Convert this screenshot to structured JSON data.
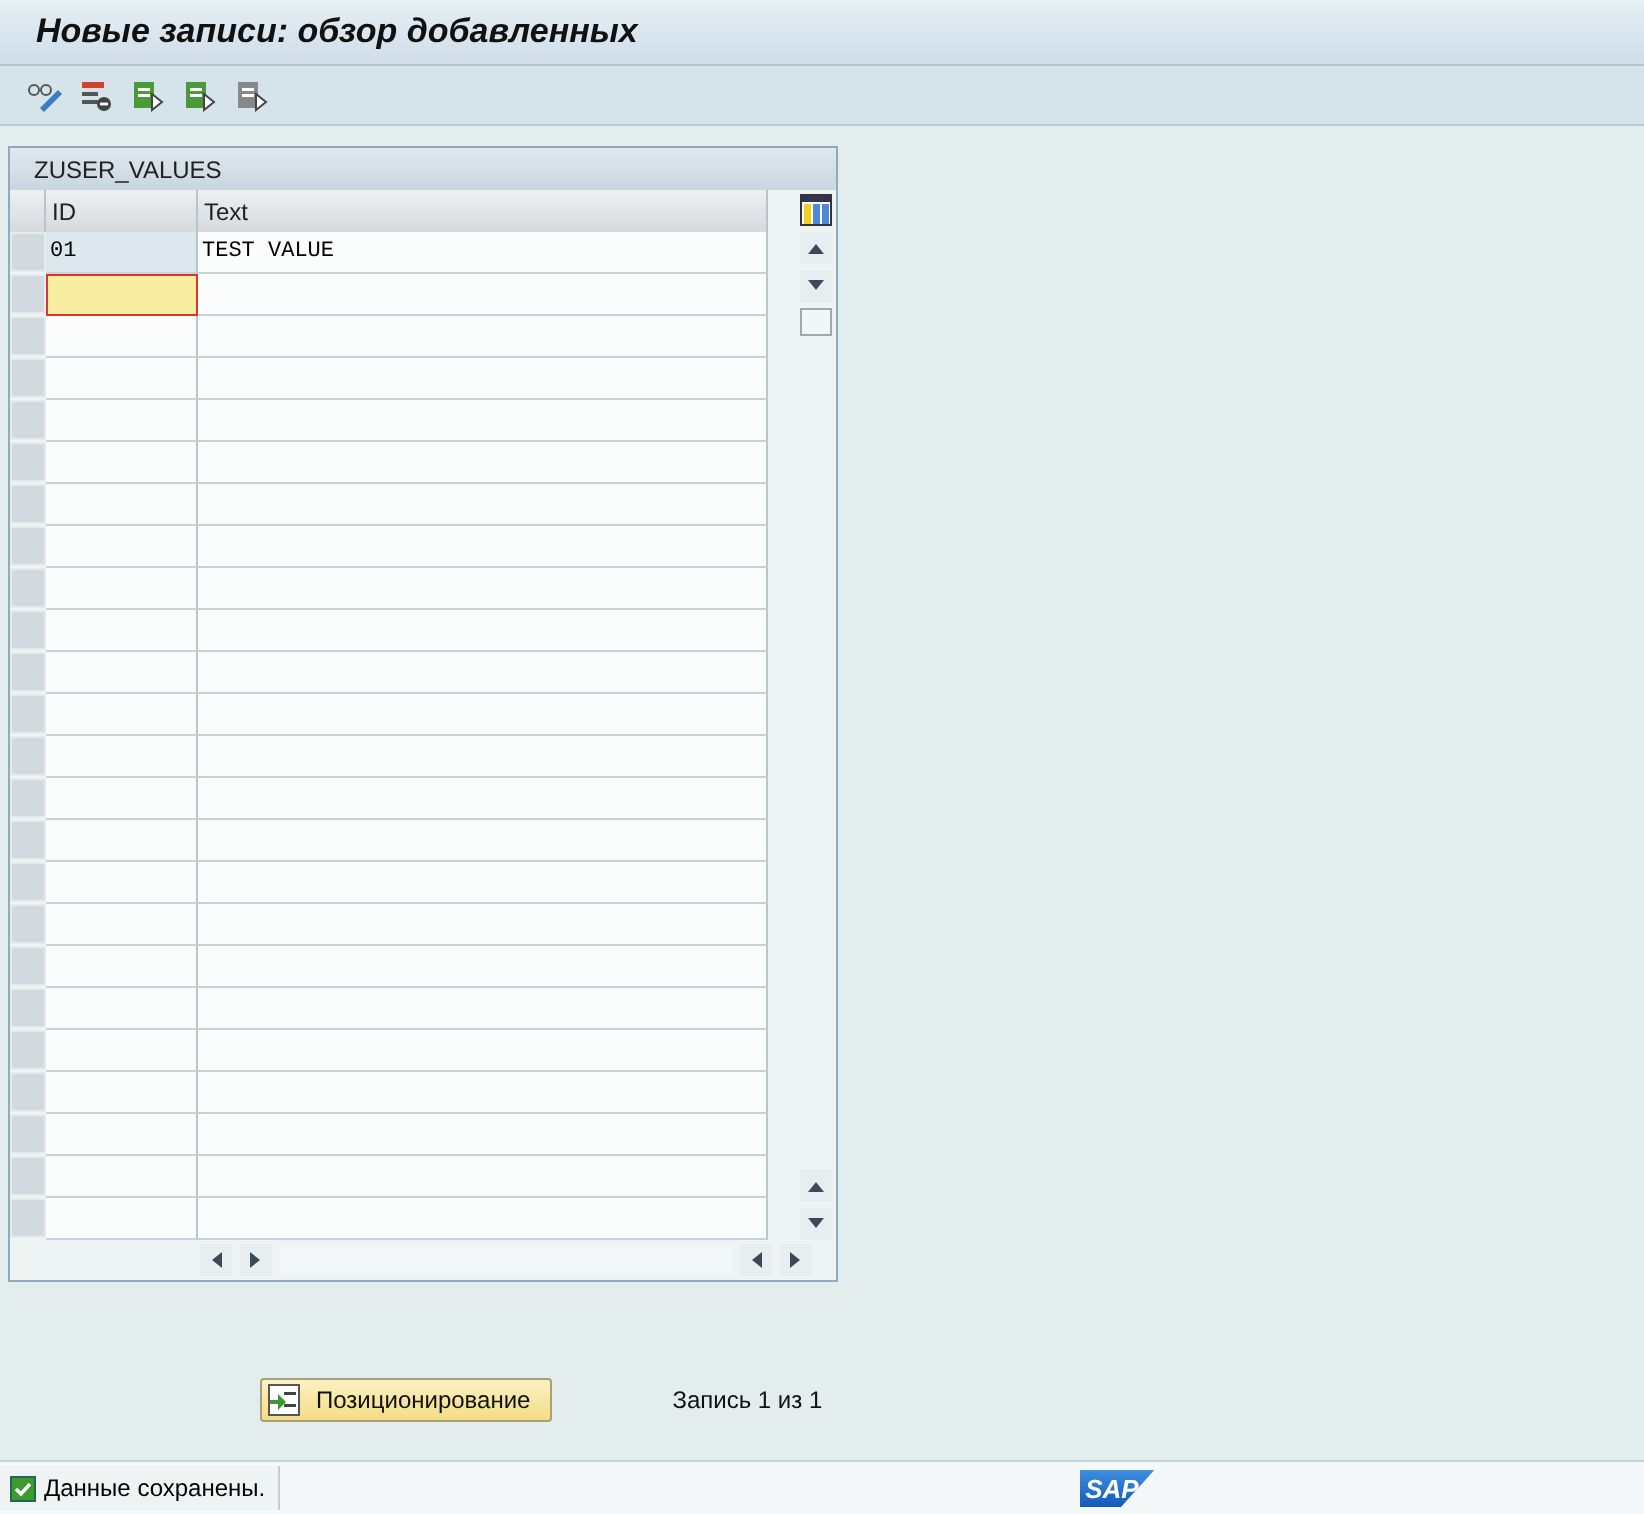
{
  "window": {
    "title": "Новые записи: обзор добавленных"
  },
  "toolbar": {
    "buttons": [
      {
        "kind": "display-change"
      },
      {
        "kind": "delete"
      },
      {
        "kind": "select-all"
      },
      {
        "kind": "select-block"
      },
      {
        "kind": "deselect-all"
      }
    ]
  },
  "table": {
    "title": "ZUSER_VALUES",
    "columns": [
      "ID",
      "Text"
    ],
    "rows": [
      {
        "id": "01",
        "text": "TEST VALUE",
        "focused": false
      },
      {
        "focused": true
      }
    ]
  },
  "position_button": {
    "label": "Позиционирование"
  },
  "record_counter": "Запись 1 из 1",
  "status_bar": {
    "kind": "success",
    "message": "Данные сохранены.",
    "logo": "SAP"
  }
}
